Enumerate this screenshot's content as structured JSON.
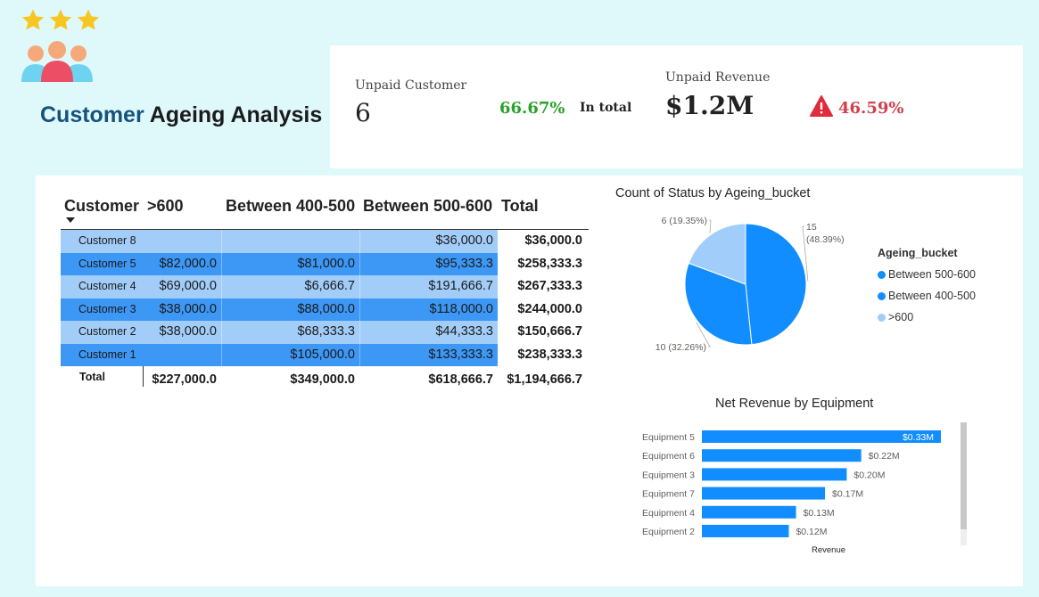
{
  "header": {
    "rating_stars": 3,
    "title_part1": "Customer",
    "title_part2": "Ageing Analysis",
    "icons": [
      "star-icon",
      "people-group-icon"
    ]
  },
  "kpi": {
    "unpaid_customer_label": "Unpaid Customer",
    "unpaid_customer_value": "6",
    "unpaid_customer_pct": "66.67%",
    "in_total_label": "In total",
    "unpaid_revenue_label": "Unpaid Revenue",
    "unpaid_revenue_value": "$1.2M",
    "unpaid_revenue_pct": "46.59%",
    "warning_icon": "warning-triangle-icon",
    "colors": {
      "green": "#2aa22a",
      "red": "#d2404c"
    }
  },
  "matrix": {
    "headers": {
      "customer": "Customer",
      "gt600": ">600",
      "b400_500": "Between 400-500",
      "b500_600": "Between 500-600",
      "total": "Total"
    },
    "rows": [
      {
        "label": "Customer 8",
        "gt600": "",
        "b400_500": "",
        "b500_600": "$36,000.0",
        "total": "$36,000.0"
      },
      {
        "label": "Customer 5",
        "gt600": "$82,000.0",
        "b400_500": "$81,000.0",
        "b500_600": "$95,333.3",
        "total": "$258,333.3"
      },
      {
        "label": "Customer 4",
        "gt600": "$69,000.0",
        "b400_500": "$6,666.7",
        "b500_600": "$191,666.7",
        "total": "$267,333.3"
      },
      {
        "label": "Customer 3",
        "gt600": "$38,000.0",
        "b400_500": "$88,000.0",
        "b500_600": "$118,000.0",
        "total": "$244,000.0"
      },
      {
        "label": "Customer 2",
        "gt600": "$38,000.0",
        "b400_500": "$68,333.3",
        "b500_600": "$44,333.3",
        "total": "$150,666.7"
      },
      {
        "label": "Customer 1",
        "gt600": "",
        "b400_500": "$105,000.0",
        "b500_600": "$133,333.3",
        "total": "$238,333.3"
      }
    ],
    "total_row": {
      "label": "Total",
      "gt600": "$227,000.0",
      "b400_500": "$349,000.0",
      "b500_600": "$618,666.7",
      "total": "$1,194,666.7"
    },
    "colors": {
      "light": "#a3cdf9",
      "dark": "#3d97f5"
    }
  },
  "chart_data": [
    {
      "type": "pie",
      "title": "Count of Status by Ageing_bucket",
      "legend_title": "Ageing_bucket",
      "legend_position": "right",
      "slices": [
        {
          "name": "Between 500-600",
          "value": 15,
          "label": "15 (48.39%)",
          "color": "#118dff"
        },
        {
          "name": "Between 400-500",
          "value": 10,
          "label": "10 (32.26%)",
          "color": "#118dff"
        },
        {
          "name": ">600",
          "value": 6,
          "label": "6 (19.35%)",
          "color": "#a0cdf9"
        }
      ]
    },
    {
      "type": "bar",
      "orientation": "horizontal",
      "title": "Net Revenue by Equipment",
      "xlabel": "Revenue",
      "categories": [
        "Equipment 5",
        "Equipment 6",
        "Equipment 3",
        "Equipment 7",
        "Equipment 4",
        "Equipment 2"
      ],
      "values": [
        0.33,
        0.22,
        0.2,
        0.17,
        0.13,
        0.12
      ],
      "value_labels": [
        "$0.33M",
        "$0.22M",
        "$0.20M",
        "$0.17M",
        "$0.13M",
        "$0.12M"
      ],
      "unit": "$M",
      "color": "#118dff",
      "xlim": [
        0,
        0.33
      ]
    }
  ]
}
